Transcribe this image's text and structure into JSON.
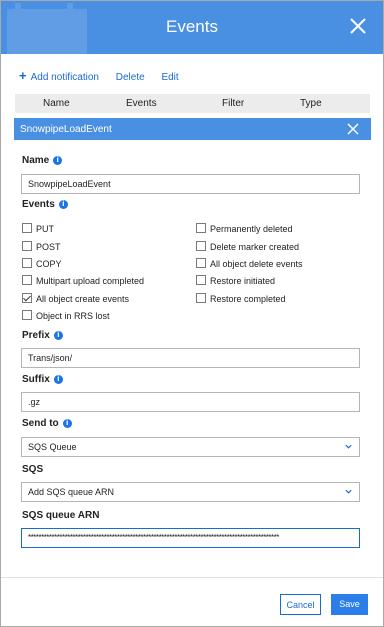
{
  "window": {
    "title": "Events"
  },
  "toolbar": {
    "add_label": "Add notification",
    "delete_label": "Delete",
    "edit_label": "Edit"
  },
  "table": {
    "headers": [
      "Name",
      "Events",
      "Filter",
      "Type"
    ],
    "selected_row": "SnowpipeLoadEvent"
  },
  "form": {
    "name_label": "Name",
    "name_value": "SnowpipeLoadEvent",
    "events_label": "Events",
    "events_left": [
      {
        "label": "PUT",
        "checked": false
      },
      {
        "label": "POST",
        "checked": false
      },
      {
        "label": "COPY",
        "checked": false
      },
      {
        "label": "Multipart upload completed",
        "checked": false
      },
      {
        "label": "All object create events",
        "checked": true
      },
      {
        "label": "Object in RRS lost",
        "checked": false
      }
    ],
    "events_right": [
      {
        "label": "Permanently deleted",
        "checked": false
      },
      {
        "label": "Delete marker created",
        "checked": false
      },
      {
        "label": "All object delete events",
        "checked": false
      },
      {
        "label": "Restore initiated",
        "checked": false
      },
      {
        "label": "Restore completed",
        "checked": false
      }
    ],
    "prefix_label": "Prefix",
    "prefix_value": "Trans/json/",
    "suffix_label": "Suffix",
    "suffix_value": ".gz",
    "send_to_label": "Send to",
    "send_to_value": "SQS Queue",
    "sqs_label": "SQS",
    "sqs_value": "Add SQS queue ARN",
    "arn_label": "SQS queue ARN",
    "arn_value": "************************************************************************************************"
  },
  "footer": {
    "cancel_label": "Cancel",
    "save_label": "Save"
  },
  "colors": {
    "accent": "#4a90e2",
    "link": "#1a6ad4",
    "primary_button": "#2b7de9"
  }
}
